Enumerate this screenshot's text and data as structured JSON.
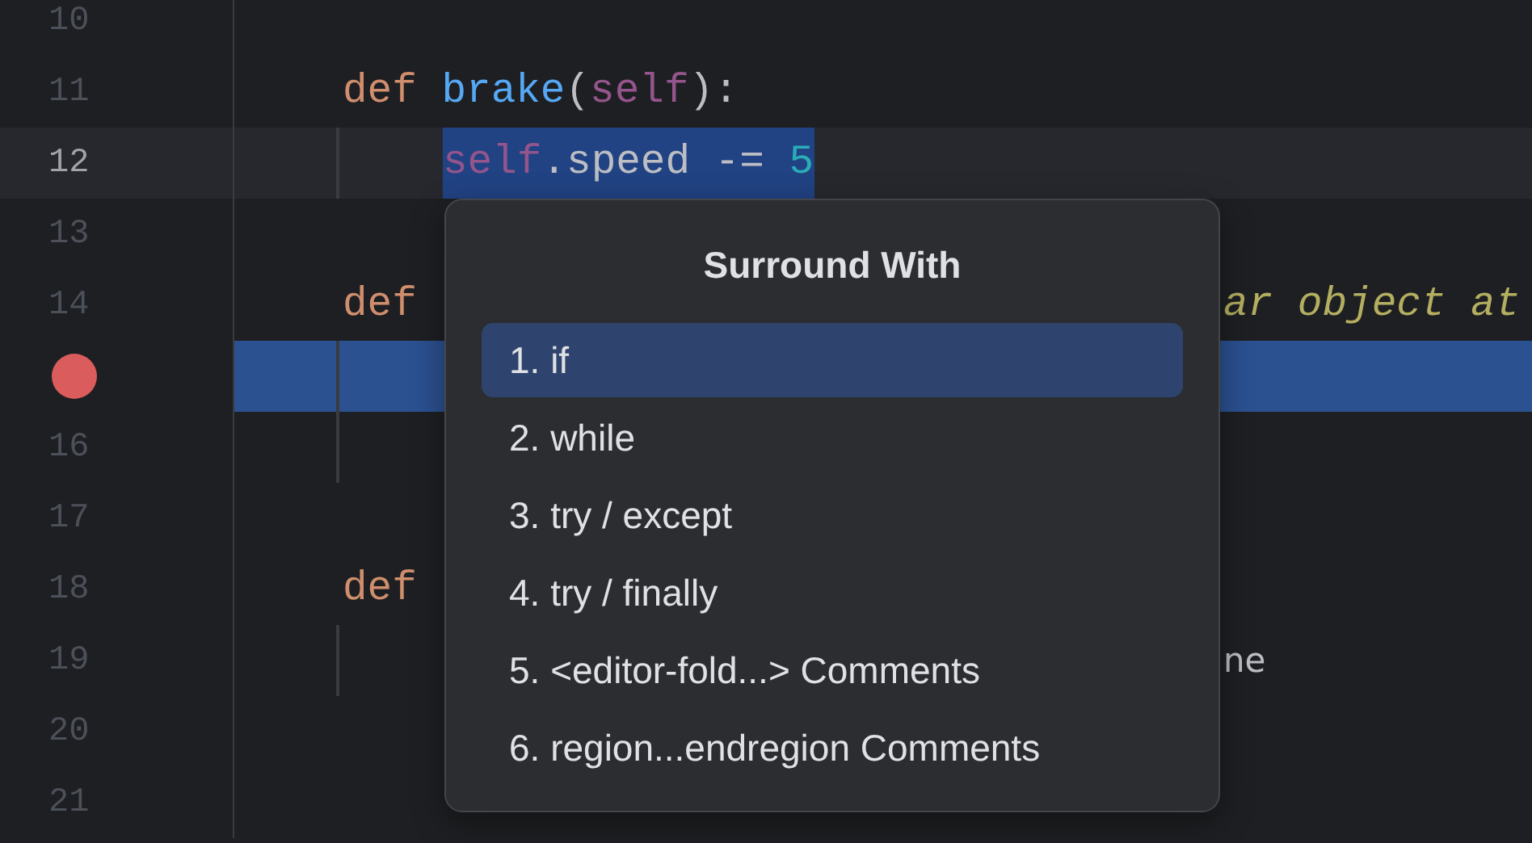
{
  "editor": {
    "lines": [
      {
        "number": "10",
        "current": false,
        "highlighted": false,
        "breakpoint": false,
        "kind": "blank"
      },
      {
        "number": "11",
        "current": false,
        "highlighted": false,
        "breakpoint": false,
        "kind": "def",
        "tokens": [
          {
            "text": "def",
            "kind": "keyword",
            "selected": false
          },
          {
            "text": "brake",
            "kind": "function",
            "selected": false
          },
          {
            "text": "(",
            "kind": "plain",
            "selected": false
          },
          {
            "text": "self",
            "kind": "self",
            "selected": false
          },
          {
            "text": "):",
            "kind": "plain",
            "selected": false
          }
        ]
      },
      {
        "number": "12",
        "current": true,
        "highlighted": false,
        "breakpoint": false,
        "kind": "body",
        "tokens": [
          {
            "text": "self",
            "kind": "self",
            "selected": true
          },
          {
            "text": ".speed -= ",
            "kind": "plain",
            "selected": true
          },
          {
            "text": "5",
            "kind": "number",
            "selected": true
          }
        ]
      },
      {
        "number": "13",
        "current": false,
        "highlighted": false,
        "breakpoint": false,
        "kind": "blank"
      },
      {
        "number": "14",
        "current": false,
        "highlighted": false,
        "breakpoint": false,
        "kind": "def",
        "tokens": [
          {
            "text": "def",
            "kind": "keyword",
            "selected": false
          }
        ],
        "tail": {
          "text": "ar object at",
          "kind": "comment"
        }
      },
      {
        "current": false,
        "highlighted": true,
        "breakpoint": true,
        "kind": "body"
      },
      {
        "number": "16",
        "current": false,
        "highlighted": false,
        "breakpoint": false,
        "kind": "body"
      },
      {
        "number": "17",
        "current": false,
        "highlighted": false,
        "breakpoint": false,
        "kind": "blank"
      },
      {
        "number": "18",
        "current": false,
        "highlighted": false,
        "breakpoint": false,
        "kind": "def",
        "tokens": [
          {
            "text": "def",
            "kind": "keyword",
            "selected": false
          }
        ]
      },
      {
        "number": "19",
        "current": false,
        "highlighted": false,
        "breakpoint": false,
        "kind": "body",
        "tail": {
          "text": "ne",
          "kind": "plain"
        }
      },
      {
        "number": "20",
        "current": false,
        "highlighted": false,
        "breakpoint": false,
        "kind": "blank"
      },
      {
        "number": "21",
        "current": false,
        "highlighted": false,
        "breakpoint": false,
        "kind": "blank"
      }
    ]
  },
  "popup": {
    "title": "Surround With",
    "items": [
      {
        "label": "1. if",
        "selected": true
      },
      {
        "label": "2. while",
        "selected": false
      },
      {
        "label": "3. try / except",
        "selected": false
      },
      {
        "label": "4. try / finally",
        "selected": false
      },
      {
        "label": "5. <editor-fold...> Comments",
        "selected": false
      },
      {
        "label": "6. region...endregion Comments",
        "selected": false
      }
    ]
  }
}
